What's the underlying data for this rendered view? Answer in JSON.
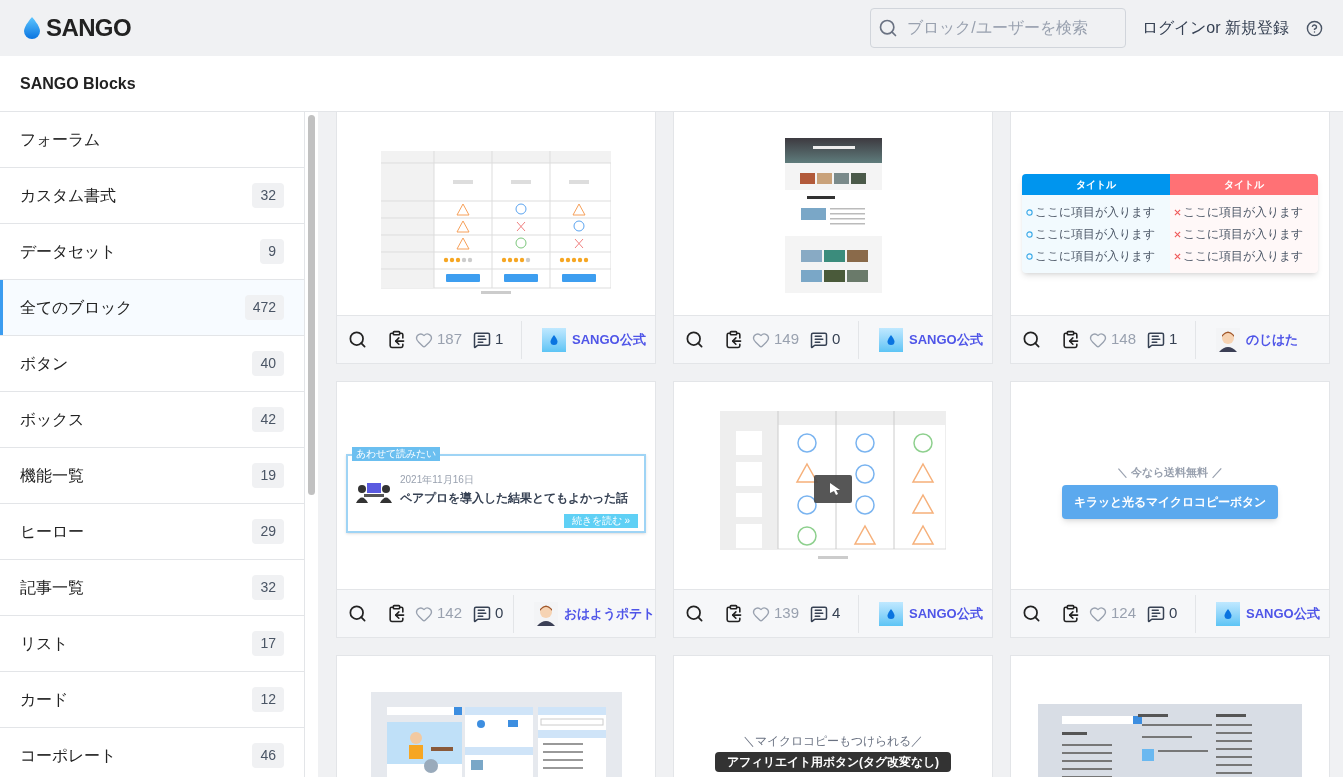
{
  "header": {
    "logo": "SANGO",
    "search": {
      "placeholder": "ブロック/ユーザーを検索"
    },
    "login": "ログインor 新規登録"
  },
  "subheader": {
    "title": "SANGO Blocks"
  },
  "sidebar": {
    "items": [
      {
        "label": "フォーラム",
        "selected": false
      },
      {
        "label": "カスタム書式",
        "count": "32",
        "selected": false
      },
      {
        "label": "データセット",
        "count": "9",
        "selected": false
      },
      {
        "label": "全てのブロック",
        "count": "472",
        "selected": true
      },
      {
        "label": "ボタン",
        "count": "40",
        "selected": false
      },
      {
        "label": "ボックス",
        "count": "42",
        "selected": false
      },
      {
        "label": "機能一覧",
        "count": "19",
        "selected": false
      },
      {
        "label": "ヒーロー",
        "count": "29",
        "selected": false
      },
      {
        "label": "記事一覧",
        "count": "32",
        "selected": false
      },
      {
        "label": "リスト",
        "count": "17",
        "selected": false
      },
      {
        "label": "カード",
        "count": "12",
        "selected": false
      },
      {
        "label": "コーポレート",
        "count": "46",
        "selected": false
      }
    ]
  },
  "cards": [
    {
      "preview": {
        "kind": "comparison-table"
      },
      "likes": "187",
      "comments": "1",
      "author": {
        "name": "SANGO公式",
        "kind": "brand"
      }
    },
    {
      "preview": {
        "kind": "landing-page"
      },
      "likes": "149",
      "comments": "0",
      "author": {
        "name": "SANGO公式",
        "kind": "brand"
      }
    },
    {
      "preview": {
        "kind": "merit-demerit",
        "columns": [
          {
            "title": "タイトル",
            "color": "#0095ee",
            "items": [
              "ここに項目が入ります",
              "ここに項目が入ります",
              "ここに項目が入ります"
            ]
          },
          {
            "title": "タイトル",
            "color": "#ff7175",
            "items": [
              "ここに項目が入ります",
              "ここに項目が入ります",
              "ここに項目が入ります"
            ]
          }
        ]
      },
      "likes": "148",
      "comments": "1",
      "author": {
        "name": "のじはた",
        "kind": "person"
      }
    },
    {
      "preview": {
        "kind": "related-post",
        "label": "あわせて読みたい",
        "date": "2021年11月16日",
        "title": "ペアプロを導入した結果とてもよかった話",
        "button": "続きを読む »"
      },
      "likes": "142",
      "comments": "0",
      "author": {
        "name": "おはようポテト",
        "kind": "person"
      }
    },
    {
      "preview": {
        "kind": "lineup-table"
      },
      "likes": "139",
      "comments": "4",
      "author": {
        "name": "SANGO公式",
        "kind": "brand"
      }
    },
    {
      "preview": {
        "kind": "microcopy-button",
        "microcopy": "＼ 今なら送料無料 ／",
        "button": "キラッと光るマイクロコピーボタン"
      },
      "likes": "124",
      "comments": "0",
      "author": {
        "name": "SANGO公式",
        "kind": "brand"
      }
    },
    {
      "preview": {
        "kind": "sidebar-widgets"
      }
    },
    {
      "preview": {
        "kind": "affiliate-button",
        "microcopy": "＼マイクロコピーもつけられる／",
        "button": "アフィリエイト用ボタン(タグ改変なし)"
      }
    },
    {
      "preview": {
        "kind": "footer-widgets"
      }
    }
  ]
}
